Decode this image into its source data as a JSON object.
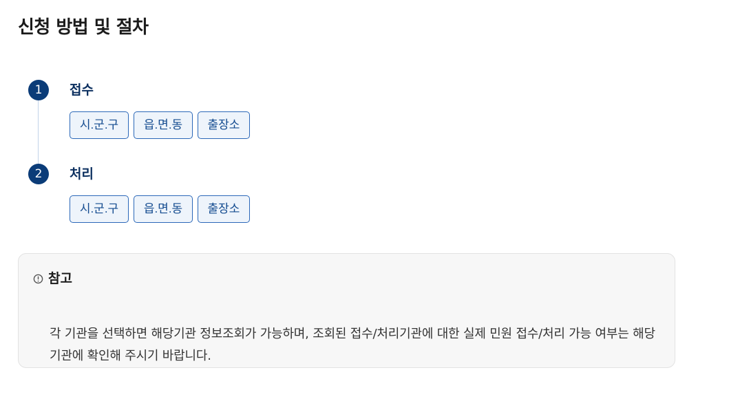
{
  "page": {
    "title": "신청 방법 및 절차"
  },
  "steps": [
    {
      "number": "1",
      "title": "접수",
      "offices": [
        "시.군.구",
        "읍.면.동",
        "출장소"
      ]
    },
    {
      "number": "2",
      "title": "처리",
      "offices": [
        "시.군.구",
        "읍.면.동",
        "출장소"
      ]
    }
  ],
  "note": {
    "icon": "alert-circle-icon",
    "title": "참고",
    "text": "각 기관을 선택하면 해당기관 정보조회가 가능하며, 조회된 접수/처리기관에 대한 실제 민원 접수/처리 가능 여부는 해당기관에 확인해 주시기 바랍니다."
  },
  "colors": {
    "step_circle": "#0b3c78",
    "step_title": "#0b2f5f",
    "tag_border": "#2a67b8",
    "tag_text": "#124a8f",
    "tag_background": "#eef4fb",
    "note_background": "#f7f7f7"
  }
}
